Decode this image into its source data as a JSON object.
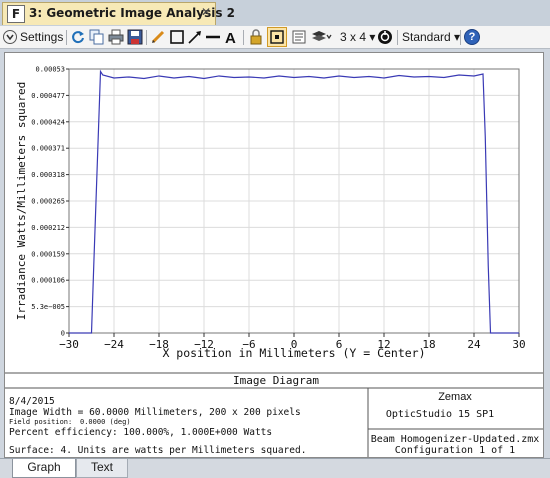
{
  "window": {
    "tab_number_icon": "F",
    "tab_title": "3: Geometric Image Analysis 2",
    "close_glyph": "✕"
  },
  "toolbar": {
    "settings_label": "Settings",
    "layout_label": "3 x 4",
    "style_label": "Standard",
    "help_glyph": "?",
    "icons": [
      "settings-chevron-icon",
      "refresh-icon",
      "copy-icon",
      "print-icon",
      "save-icon",
      "pencil-icon",
      "rectangle-icon",
      "arrow-line-icon",
      "line-icon",
      "text-icon",
      "lock-icon",
      "fit-icon",
      "export-icon",
      "layers-icon",
      "rotate-icon",
      "help-icon"
    ]
  },
  "chart_data": {
    "type": "line",
    "xlabel": "X position in Millimeters (Y = Center)",
    "ylabel": "Irradiance Watts/Millimeters squared",
    "x_ticks": [
      -30,
      -24,
      -18,
      -12,
      -6,
      0,
      6,
      12,
      18,
      24,
      30
    ],
    "x_tick_labels": [
      "−30",
      "−24",
      "−18",
      "−12",
      "−6",
      "0",
      "6",
      "12",
      "18",
      "24",
      "30"
    ],
    "y_ticks": [
      0,
      5.3e-05,
      0.000106,
      0.000159,
      0.000212,
      0.000265,
      0.000318,
      0.000371,
      0.000424,
      0.000477,
      0.00053
    ],
    "y_tick_labels": [
      "0",
      "5.3e−005",
      "0.000106",
      "0.000159",
      "0.000212",
      "0.000265",
      "0.000318",
      "0.000371",
      "0.000424",
      "0.000477",
      "0.00053"
    ],
    "xlim": [
      -30,
      30
    ],
    "ylim": [
      0,
      0.00053
    ],
    "grid": true,
    "line_color": "#3a3ab5",
    "series": [
      {
        "x": [
          -30,
          -27.6,
          -27.0,
          -26.7,
          -26.4,
          -26.1,
          -25.8,
          -25.5,
          -24,
          -22,
          -20,
          -18,
          -16,
          -14,
          -12,
          -10,
          -8,
          -6,
          -4,
          -2,
          0,
          2,
          4,
          6,
          8,
          10,
          12,
          14,
          16,
          18,
          20,
          22,
          24,
          25.2,
          25.5,
          25.7,
          25.9,
          26.2,
          30
        ],
        "y": [
          0,
          0,
          0,
          0.000135,
          0.000265,
          0.000395,
          0.000525,
          0.000518,
          0.000512,
          0.000514,
          0.000511,
          0.000516,
          0.000512,
          0.000515,
          0.000511,
          0.000516,
          0.000513,
          0.000514,
          0.000512,
          0.000516,
          0.000513,
          0.000515,
          0.000512,
          0.000516,
          0.000513,
          0.000515,
          0.000512,
          0.000517,
          0.000514,
          0.000515,
          0.000513,
          0.000518,
          0.000516,
          0.00052,
          0.000395,
          0.000265,
          0.000135,
          0,
          0
        ]
      }
    ]
  },
  "info": {
    "title": "Image Diagram",
    "date": "8/4/2015",
    "line1": "Image Width = 60.0000 Millimeters, 200 x 200 pixels",
    "field_label": "Field position:",
    "field_value": "0.0000 (deg)",
    "line3": "Percent efficiency: 100.000%, 1.000E+000 Watts",
    "line4": "Surface: 4. Units are watts per Millimeters squared.",
    "company": "Zemax",
    "product": "OpticStudio 15 SP1",
    "file": "Beam Homogenizer-Updated.zmx",
    "config": "Configuration 1 of 1"
  },
  "bottom_tabs": {
    "graph": "Graph",
    "text": "Text"
  }
}
